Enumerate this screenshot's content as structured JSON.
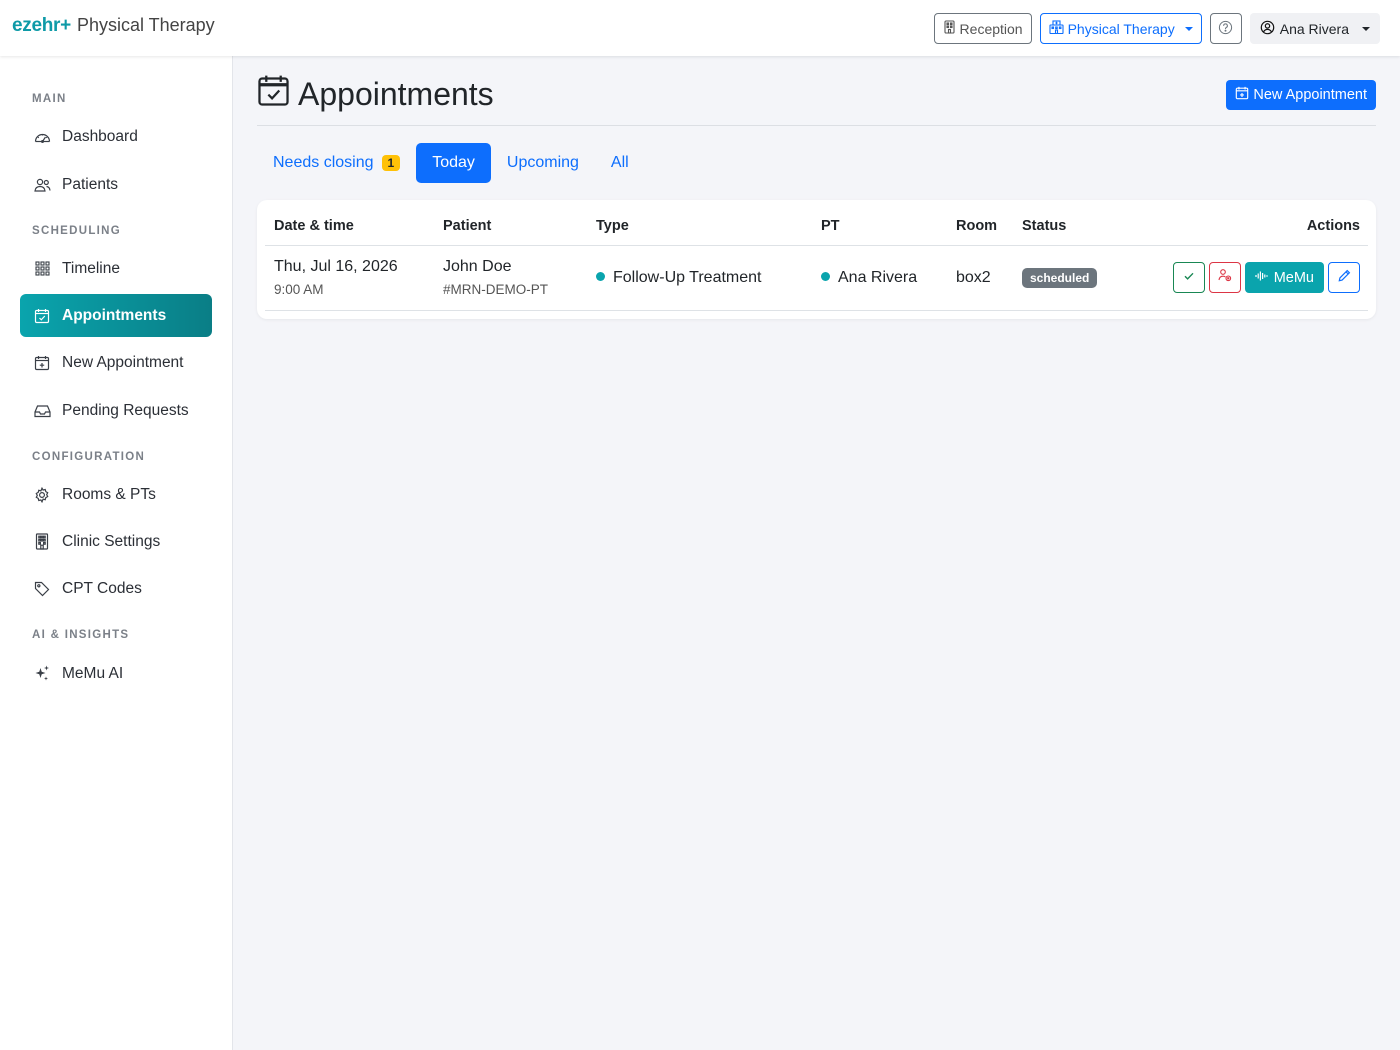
{
  "brand": {
    "logo": "ezehr+",
    "app_name": "Physical Therapy"
  },
  "topbar": {
    "reception_label": "Reception",
    "department_label": "Physical Therapy",
    "help_icon": "question-circle-icon",
    "user_name": "Ana Rivera"
  },
  "sidebar": {
    "sections": {
      "main": "MAIN",
      "scheduling": "SCHEDULING",
      "configuration": "CONFIGURATION",
      "ai": "AI & INSIGHTS"
    },
    "items": {
      "dashboard": "Dashboard",
      "patients": "Patients",
      "timeline": "Timeline",
      "appointments": "Appointments",
      "new_appointment": "New Appointment",
      "pending_requests": "Pending Requests",
      "rooms_pts": "Rooms & PTs",
      "clinic_settings": "Clinic Settings",
      "cpt_codes": "CPT Codes",
      "memu_ai": "MeMu AI"
    },
    "active_item": "Appointments"
  },
  "page": {
    "title": "Appointments",
    "new_button": "New Appointment"
  },
  "tabs": {
    "needs_closing": "Needs closing",
    "needs_closing_count": "1",
    "today": "Today",
    "upcoming": "Upcoming",
    "all": "All",
    "active": "Today"
  },
  "table": {
    "headers": {
      "datetime": "Date & time",
      "patient": "Patient",
      "type": "Type",
      "pt": "PT",
      "room": "Room",
      "status": "Status",
      "actions": "Actions"
    },
    "rows": [
      {
        "date": "Thu, Jul 16, 2026",
        "time": "9:00 AM",
        "patient": "John Doe",
        "mrn": "#MRN-DEMO-PT",
        "type": "Follow-Up Treatment",
        "pt": "Ana Rivera",
        "room": "box2",
        "status": "scheduled",
        "memu_label": "MeMu"
      }
    ]
  },
  "colors": {
    "accent_teal": "#0aa4ad",
    "primary_blue": "#0d6efd",
    "warning_yellow": "#ffc107",
    "status_gray": "#6c757d",
    "success_green": "#198754",
    "danger_red": "#dc3545"
  }
}
